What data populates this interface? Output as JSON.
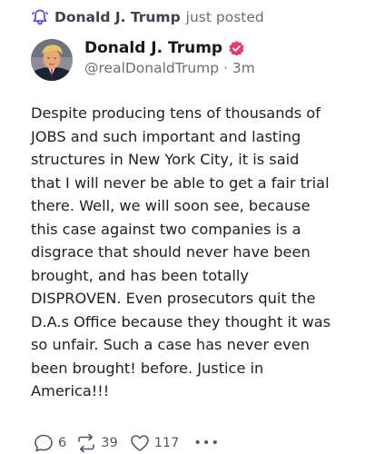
{
  "notification": {
    "icon": "bell-icon",
    "name": "Donald J. Trump",
    "action": "just posted"
  },
  "post": {
    "author": {
      "name": "Donald J. Trump",
      "verified_icon": "verified-badge-icon",
      "handle": "@realDonaldTrump",
      "separator": "·",
      "time": "3m"
    },
    "lines": [
      "Despite producing tens of thousands of",
      "JOBS and such important and lasting",
      "structures in New York City, it is said",
      "that I will never be able to get a fair trial",
      "there. Well, we will soon see, because",
      "this case against two companies is a",
      "disgrace that should never have been",
      "brought, and has been totally",
      "DISPROVEN. Even prosecutors quit the",
      "D.A.s Office because they thought it was",
      "so unfair. Such a case has never even",
      "been brought! before. Justice in",
      "America!!!"
    ],
    "actions": {
      "reply_count": "6",
      "retruth_count": "39",
      "like_count": "117",
      "more_label": "•••"
    }
  },
  "colors": {
    "accent": "#5448ee",
    "text": "#1f1f24",
    "muted": "#6a6c78",
    "verified": "#e8386f"
  }
}
